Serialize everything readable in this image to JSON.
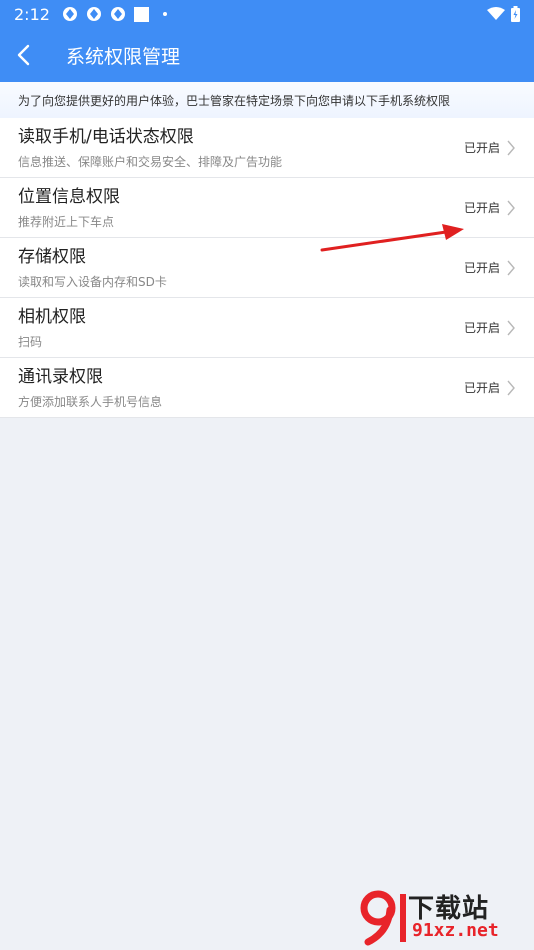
{
  "status_bar": {
    "time": "2:12"
  },
  "header": {
    "title": "系统权限管理"
  },
  "notice": {
    "text": "为了向您提供更好的用户体验，巴士管家在特定场景下向您申请以下手机系统权限"
  },
  "permissions": [
    {
      "title": "读取手机/电话状态权限",
      "desc": "信息推送、保障账户和交易安全、排障及广告功能",
      "status": "已开启"
    },
    {
      "title": "位置信息权限",
      "desc": "推荐附近上下车点",
      "status": "已开启"
    },
    {
      "title": "存储权限",
      "desc": "读取和写入设备内存和SD卡",
      "status": "已开启"
    },
    {
      "title": "相机权限",
      "desc": "扫码",
      "status": "已开启"
    },
    {
      "title": "通讯录权限",
      "desc": "方便添加联系人手机号信息",
      "status": "已开启"
    }
  ],
  "watermark": {
    "line1": "下载站",
    "line2": "91xz.net"
  },
  "colors": {
    "primary": "#3f8df5",
    "background": "#eef1f6",
    "annotation": "#e02020",
    "watermark_red": "#e8242a"
  }
}
